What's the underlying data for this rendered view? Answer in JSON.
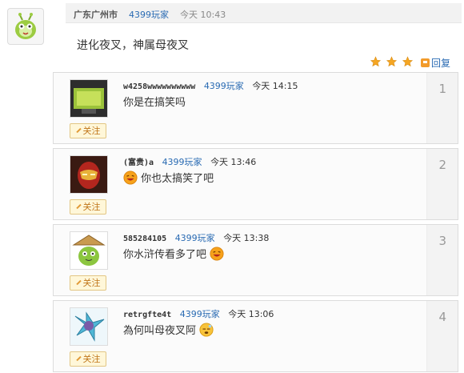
{
  "main": {
    "location": "广东广州市",
    "group": "4399玩家",
    "time": "今天 10:43",
    "text": "进化夜叉，神属母夜叉",
    "reply_label": "回复"
  },
  "comments": [
    {
      "user": "w4258wwwwwwwwww",
      "group": "4399玩家",
      "time": "今天 14:15",
      "text_before": "",
      "text": "你是在搞笑吗",
      "text_after": "",
      "follow": "关注",
      "num": "1"
    },
    {
      "user": "(富贵)a",
      "group": "4399玩家",
      "time": "今天 13:46",
      "text_before": "",
      "text": "你也太搞笑了吧",
      "text_after": "",
      "follow": "关注",
      "num": "2"
    },
    {
      "user": "585284105",
      "group": "4399玩家",
      "time": "今天 13:38",
      "text_before": "",
      "text": "你水浒传看多了吧",
      "text_after": "",
      "follow": "关注",
      "num": "3"
    },
    {
      "user": "retrgfte4t",
      "group": "4399玩家",
      "time": "今天 13:06",
      "text_before": "",
      "text": "為何叫母夜叉阿",
      "text_after": "",
      "follow": "关注",
      "num": "4"
    }
  ],
  "colors": {
    "accent": "#2a6bb3",
    "star": "#f5a623",
    "follow_bg": "#fff7d9"
  }
}
